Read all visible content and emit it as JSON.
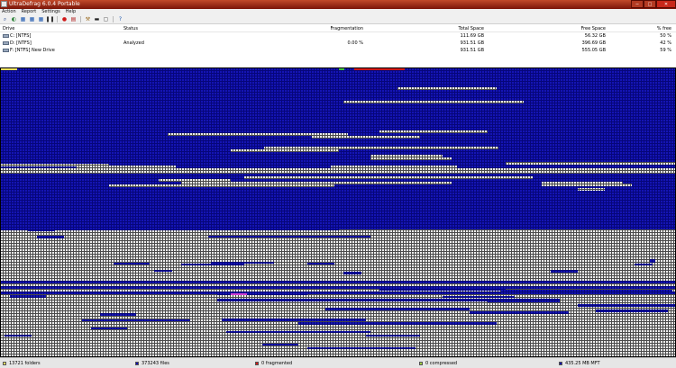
{
  "window": {
    "title": "UltraDefrag 6.0.4 Portable",
    "minimize": "─",
    "maximize": "□",
    "close": "✕"
  },
  "menu": {
    "items": [
      {
        "label": "Action"
      },
      {
        "label": "Report"
      },
      {
        "label": "Settings"
      },
      {
        "label": "Help"
      }
    ]
  },
  "toolbar": {
    "buttons": [
      {
        "name": "analyze-icon",
        "glyph": "⌕",
        "color": "#2a4a90"
      },
      {
        "name": "defrag-icon",
        "glyph": "◐",
        "color": "#1e7a2a"
      },
      {
        "name": "quick-optimize-icon",
        "glyph": "▦",
        "color": "#1d58b0"
      },
      {
        "name": "full-optimize-icon",
        "glyph": "▦",
        "color": "#1d58b0"
      },
      {
        "name": "mft-optimize-icon",
        "glyph": "▦",
        "color": "#1d58b0"
      },
      {
        "name": "pause-icon",
        "glyph": "❚❚",
        "color": "#333333"
      },
      {
        "name": "stop-icon",
        "glyph": "●",
        "color": "#d01818"
      },
      {
        "name": "report-icon",
        "glyph": "▤",
        "color": "#b02020"
      },
      {
        "name": "options-icon",
        "glyph": "⚒",
        "color": "#9a6a20"
      },
      {
        "name": "boot-time-icon",
        "glyph": "▬",
        "color": "#202020"
      },
      {
        "name": "script-icon",
        "glyph": "▢",
        "color": "#404040"
      },
      {
        "name": "help-icon",
        "glyph": "?",
        "color": "#1d58b0"
      }
    ]
  },
  "drive_list": {
    "headers": {
      "drive": "Drive",
      "status": "Status",
      "fragmentation": "Fragmentation",
      "total": "Total Space",
      "free": "Free Space",
      "pct_free": "% free"
    },
    "rows": [
      {
        "drive": "C: [NTFS]",
        "status": "",
        "fragmentation": "",
        "total": "111.69 GB",
        "free": "56.32 GB",
        "pct_free": "50 %"
      },
      {
        "drive": "D: [NTFS]",
        "status": "Analyzed",
        "fragmentation": "0.00 %",
        "total": "931.51 GB",
        "free": "396.69 GB",
        "pct_free": "42 %"
      },
      {
        "drive": "F: [NTFS]  New Drive",
        "status": "",
        "fragmentation": "",
        "total": "931.51 GB",
        "free": "555.05 GB",
        "pct_free": "59 %"
      }
    ]
  },
  "cluster_map": {
    "colors": {
      "free": "#1010a8",
      "used": "#e8e8e8",
      "fragmented": "#d01818",
      "system": "#f0e060",
      "mft": "#d040d0",
      "compressed": "#40c040"
    }
  },
  "status_bar": [
    {
      "text": "13721 folders",
      "color": "#f0e060"
    },
    {
      "text": "373243 files",
      "color": "#1010a8"
    },
    {
      "text": "0 fragmented",
      "color": "#d01818"
    },
    {
      "text": "0 compressed",
      "color": "#a0d040"
    },
    {
      "text": "435.25 MB MFT",
      "color": "#1010a8"
    }
  ]
}
